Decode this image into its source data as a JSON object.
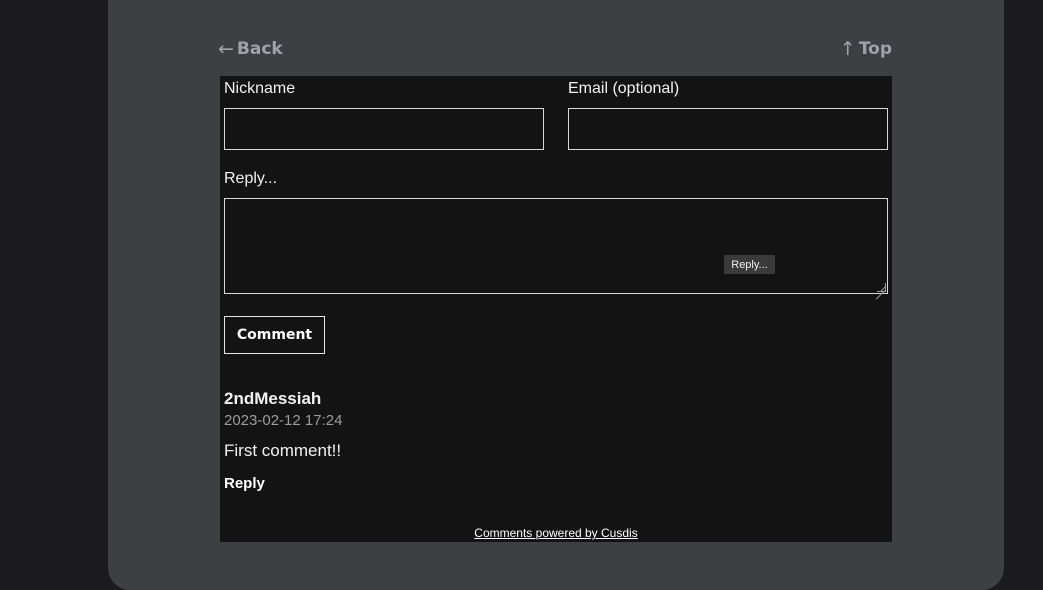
{
  "nav": {
    "back_label": "Back",
    "back_icon": "←",
    "top_label": "Top",
    "top_icon": "↑"
  },
  "form": {
    "nickname_label": "Nickname",
    "nickname_value": "",
    "email_label": "Email (optional)",
    "email_value": "",
    "reply_label": "Reply...",
    "reply_value": "",
    "reply_tooltip": "Reply...",
    "submit_label": "Comment"
  },
  "comments": [
    {
      "author": "2ndMessiah",
      "timestamp": "2023-02-12 17:24",
      "body": "First comment!!",
      "reply_label": "Reply"
    }
  ],
  "footer": {
    "powered_by": "Comments powered by Cusdis"
  },
  "colors": {
    "page_bg": "#1b1b1d",
    "card_bg": "#3e3f43",
    "comments_bg": "#131313",
    "nav_text": "#a1a2a8",
    "muted_text": "#9c9c9c"
  }
}
